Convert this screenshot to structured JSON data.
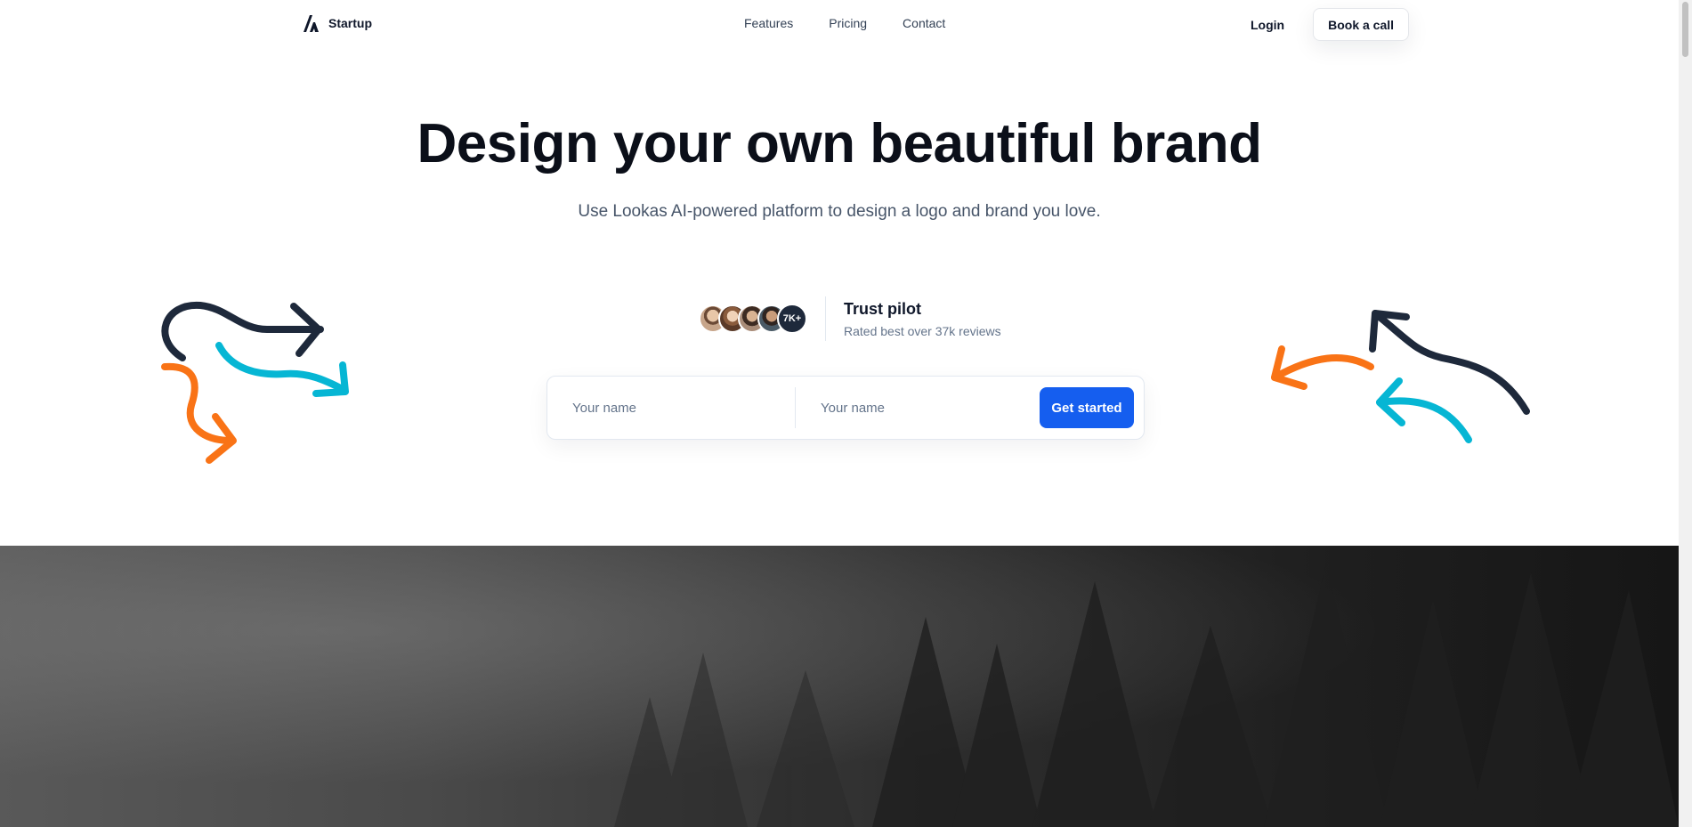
{
  "nav": {
    "brand": "Startup",
    "links": [
      "Features",
      "Pricing",
      "Contact"
    ],
    "login": "Login",
    "cta": "Book a call"
  },
  "hero": {
    "headline": "Design your own beautiful brand",
    "subhead": "Use Lookas AI-powered platform to design a logo and brand you love."
  },
  "trust": {
    "count_badge": "7K+",
    "title": "Trust pilot",
    "subtitle": "Rated best over 37k reviews"
  },
  "form": {
    "name_placeholder_1": "Your name",
    "name_placeholder_2": "Your name",
    "submit_label": "Get started"
  },
  "colors": {
    "primary": "#155eef",
    "arrow_dark": "#1e293b",
    "arrow_cyan": "#06b6d4",
    "arrow_orange": "#f97316"
  }
}
